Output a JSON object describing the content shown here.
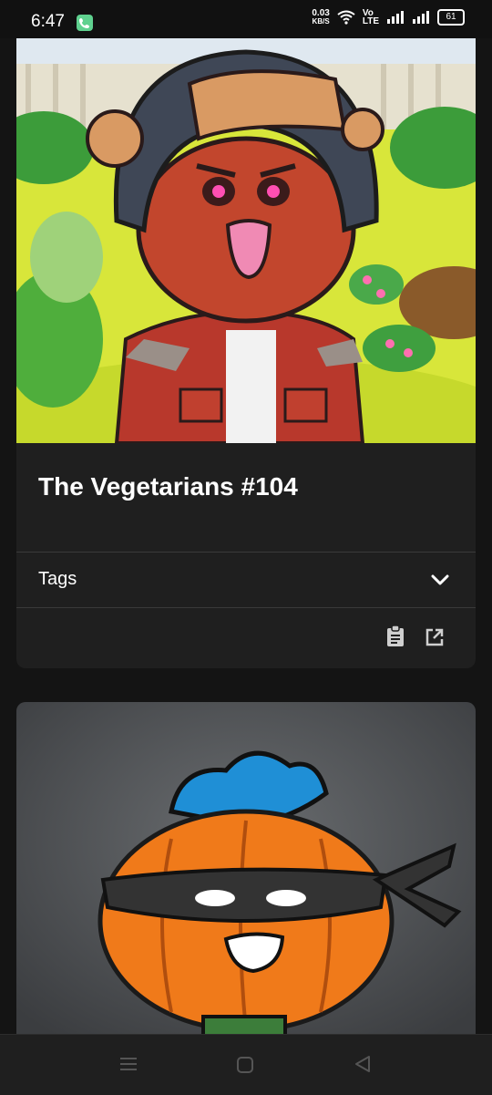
{
  "status_bar": {
    "time": "6:47",
    "net_speed_value": "0.03",
    "net_speed_unit": "KB/S",
    "volte_line1": "Vo",
    "volte_line2": "LTE",
    "battery": "61"
  },
  "cards": [
    {
      "title": "The Vegetarians #104",
      "tags_label": "Tags",
      "image_desc": "cartoon-character-ushanka-hat-red-jacket"
    },
    {
      "image_desc": "cartoon-pumpkin-character-blue-mohawk-mask"
    }
  ],
  "colors": {
    "background": "#141414",
    "card": "#1f1f1f",
    "divider": "#3a3a3a",
    "accent_call": "#5fd18f"
  }
}
